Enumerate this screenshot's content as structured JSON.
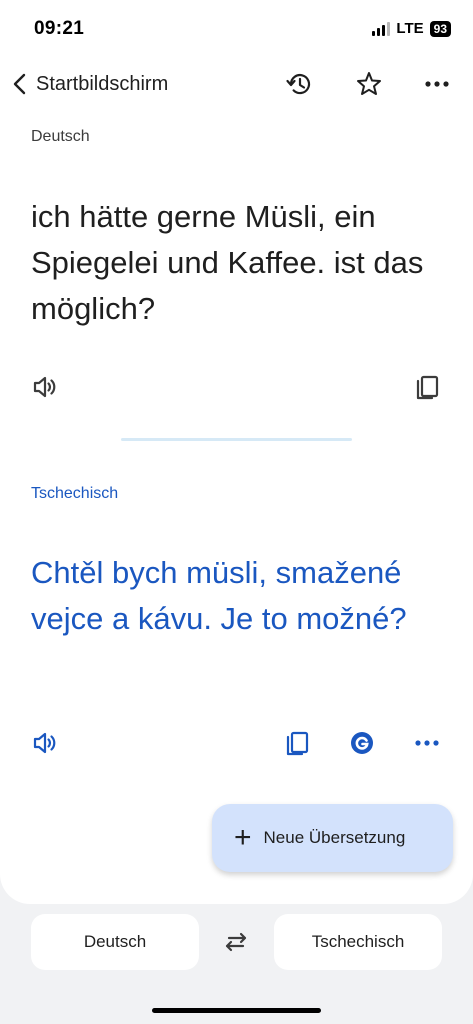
{
  "status_bar": {
    "time": "09:21",
    "network": "LTE",
    "battery": "93"
  },
  "header": {
    "back_label": "Startbildschirm",
    "icons": [
      "back-chevron-icon",
      "history-icon",
      "star-icon",
      "more-icon"
    ]
  },
  "source": {
    "language": "Deutsch",
    "text": "ich hätte gerne Müsli, ein Spiegelei und Kaffee. ist das möglich?"
  },
  "target": {
    "language": "Tschechisch",
    "text": "Chtěl bych müsli, smažené vejce a kávu. Je to možné?"
  },
  "fab": {
    "label": "Neue Übersetzung"
  },
  "language_bar": {
    "source": "Deutsch",
    "target": "Tschechisch"
  },
  "colors": {
    "accent": "#1a57c0",
    "fab_bg": "#d3e2fc",
    "divider": "#d6e9f6",
    "background": "#f1f2f4"
  }
}
